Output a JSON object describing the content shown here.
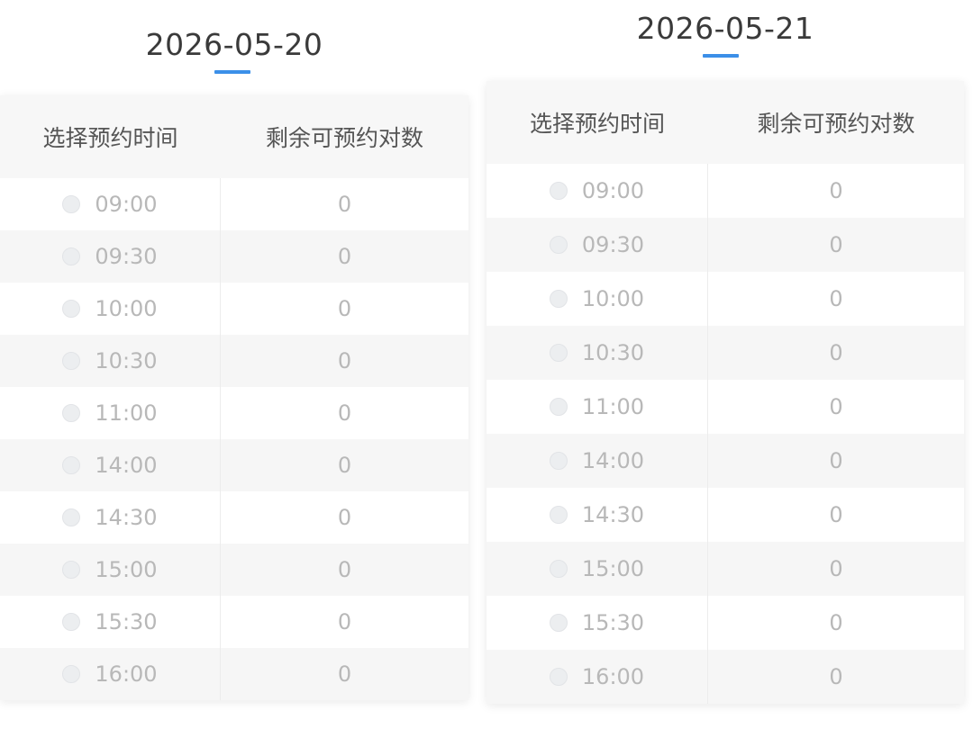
{
  "days": [
    {
      "date": "2026-05-20",
      "columns": {
        "time": "选择预约时间",
        "remaining": "剩余可预约对数"
      },
      "slots": [
        {
          "time": "09:00",
          "remaining": "0"
        },
        {
          "time": "09:30",
          "remaining": "0"
        },
        {
          "time": "10:00",
          "remaining": "0"
        },
        {
          "time": "10:30",
          "remaining": "0"
        },
        {
          "time": "11:00",
          "remaining": "0"
        },
        {
          "time": "14:00",
          "remaining": "0"
        },
        {
          "time": "14:30",
          "remaining": "0"
        },
        {
          "time": "15:00",
          "remaining": "0"
        },
        {
          "time": "15:30",
          "remaining": "0"
        },
        {
          "time": "16:00",
          "remaining": "0"
        }
      ]
    },
    {
      "date": "2026-05-21",
      "columns": {
        "time": "选择预约时间",
        "remaining": "剩余可预约对数"
      },
      "slots": [
        {
          "time": "09:00",
          "remaining": "0"
        },
        {
          "time": "09:30",
          "remaining": "0"
        },
        {
          "time": "10:00",
          "remaining": "0"
        },
        {
          "time": "10:30",
          "remaining": "0"
        },
        {
          "time": "11:00",
          "remaining": "0"
        },
        {
          "time": "14:00",
          "remaining": "0"
        },
        {
          "time": "14:30",
          "remaining": "0"
        },
        {
          "time": "15:00",
          "remaining": "0"
        },
        {
          "time": "15:30",
          "remaining": "0"
        },
        {
          "time": "16:00",
          "remaining": "0"
        }
      ]
    }
  ],
  "colors": {
    "accent": "#3b8fe8",
    "header_bg": "#f7f7f7",
    "row_alt_bg": "#f6f6f6",
    "disabled_text": "#b8b8b8"
  }
}
